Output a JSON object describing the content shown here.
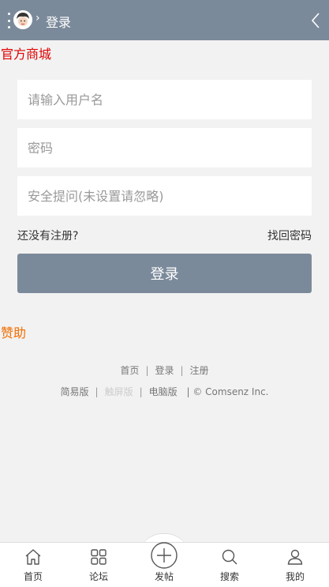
{
  "header": {
    "breadcrumb_separator": "›",
    "title": "登录",
    "menu_icon": "vertical-dots-icon",
    "back_icon": "chevron-left-icon",
    "background": "#7b8a9a"
  },
  "site_name": "官方商城",
  "form": {
    "username_placeholder": "请输入用户名",
    "password_placeholder": "密码",
    "question_placeholder": "安全提问(未设置请忽略)",
    "register_link": "还没有注册?",
    "forgot_link": "找回密码",
    "submit_label": "登录"
  },
  "sponsor": "赞助",
  "footer": {
    "nav": [
      "首页",
      "登录",
      "注册"
    ],
    "versions": [
      "简易版",
      "触屏版",
      "电脑版"
    ],
    "copyright": "| © Comsenz Inc.",
    "separator": "|"
  },
  "tabbar": [
    {
      "label": "首页",
      "icon": "home-icon"
    },
    {
      "label": "论坛",
      "icon": "grid-icon"
    },
    {
      "label": "发帖",
      "icon": "plus-circle-icon"
    },
    {
      "label": "搜索",
      "icon": "search-icon"
    },
    {
      "label": "我的",
      "icon": "user-icon"
    }
  ],
  "colors": {
    "accent": "#7b8a9a",
    "site_name": "#e00000",
    "sponsor": "#f26c00",
    "background": "#f2f2f2"
  }
}
